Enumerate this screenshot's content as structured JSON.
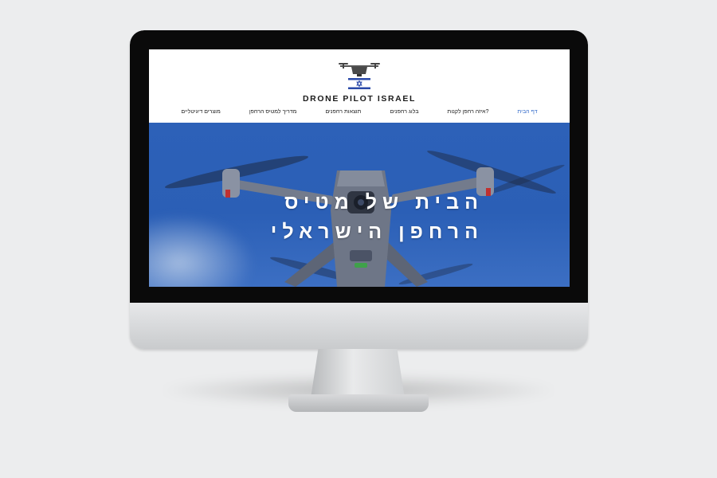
{
  "site": {
    "brand": "DRONE PILOT ISRAEL",
    "nav": [
      {
        "label": "דף הבית",
        "active": true
      },
      {
        "label": "איזה רחפן לקנות?",
        "active": false
      },
      {
        "label": "בלוג רחפנים",
        "active": false
      },
      {
        "label": "תוצאות רחפנים",
        "active": false
      },
      {
        "label": "מדריך למטיס הרחפן",
        "active": false
      },
      {
        "label": "מוצרים דיגיטליים",
        "active": false
      }
    ],
    "hero": {
      "line1": "הבית של מטיס",
      "line2": "הרחפן הישראלי"
    }
  },
  "colors": {
    "accent": "#3a70cc",
    "hero_blue": "#2d61b8",
    "flag_blue": "#2a49a8"
  },
  "icons": {
    "logo": "drone-with-israel-flag-icon"
  }
}
